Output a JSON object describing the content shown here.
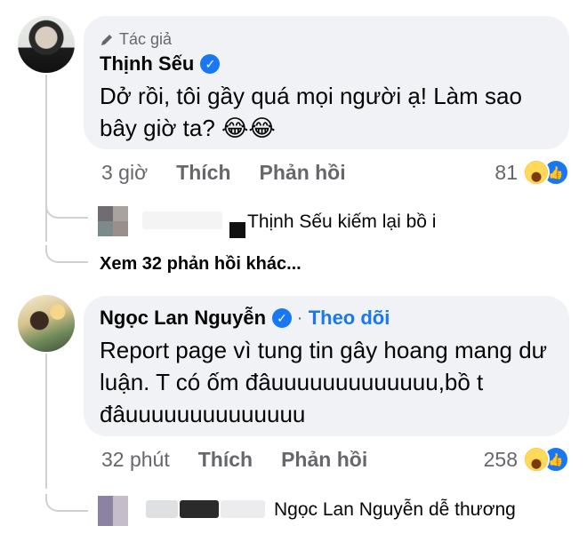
{
  "comment1": {
    "author_badge": "Tác giả",
    "author": "Thịnh Sếu",
    "text": "Dở rồi, tôi gầy quá mọi người ạ! Làm sao bây giờ ta? 😂😂",
    "time": "3 giờ",
    "like_label": "Thích",
    "reply_label": "Phản hồi",
    "reaction_count": "81",
    "reply_preview": "Thịnh Sếu kiếm lại bồ i",
    "more_replies": "Xem 32 phản hồi khác..."
  },
  "comment2": {
    "author": "Ngọc Lan Nguyễn",
    "separator": "·",
    "follow_label": "Theo dõi",
    "text": "Report page vì tung tin gây hoang mang dư luận. T có ốm đâuuuuuuuuuuuuu,bồ t đâuuuuuuuuuuuuuu",
    "time": "32 phút",
    "like_label": "Thích",
    "reply_label": "Phản hồi",
    "reaction_count": "258",
    "reply_preview": "Ngọc Lan Nguyễn dễ thương"
  },
  "colors": {
    "accent": "#1877f2",
    "bubble": "#f0f2f5",
    "secondary_text": "#65676b"
  },
  "icons": [
    "pen-icon",
    "verified-icon",
    "haha-icon",
    "like-icon"
  ]
}
